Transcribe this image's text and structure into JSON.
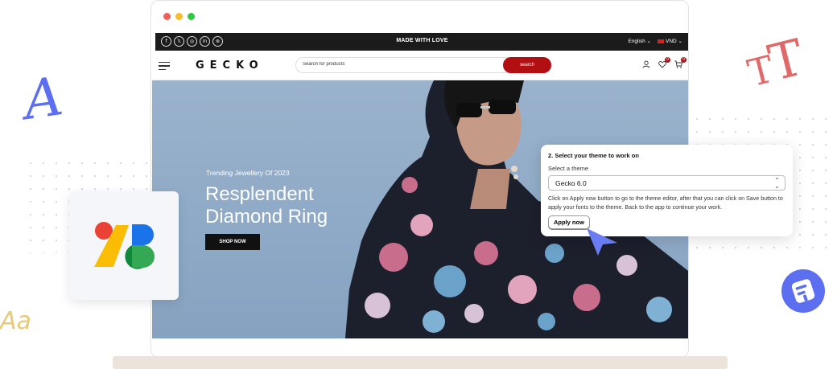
{
  "decorations": {
    "letter_a": "A",
    "letter_tt_big": "T",
    "letter_tt_small": "T",
    "letter_aa": "Aa"
  },
  "store": {
    "topbar": {
      "socials": [
        "f",
        "𝕏",
        "◎",
        "in",
        "⊛"
      ],
      "center_text": "MADE WITH LOVE",
      "language": "English ⌄",
      "currency": "VND ⌄"
    },
    "header": {
      "logo": "GECKO",
      "search_placeholder": "Search for products",
      "search_button": "search",
      "wishlist_count": "0",
      "cart_count": "0"
    },
    "hero": {
      "subtitle": "Trending Jewellery Of 2023",
      "title": "Resplendent Diamond Ring",
      "button": "SHOP NOW"
    }
  },
  "popup": {
    "title": "2. Select your theme to work on",
    "select_label": "Select a theme",
    "selected_theme": "Gecko 6.0",
    "help_text": "Click on Apply now button to go to the theme editor, after that you can click on Save button to apply your fonts to the theme. Back to the app to continue your work.",
    "apply_button": "Apply now"
  },
  "colors": {
    "brand_red": "#b10f12",
    "accent_blue": "#5b6ff0",
    "hero_bg": "#8faac7"
  }
}
